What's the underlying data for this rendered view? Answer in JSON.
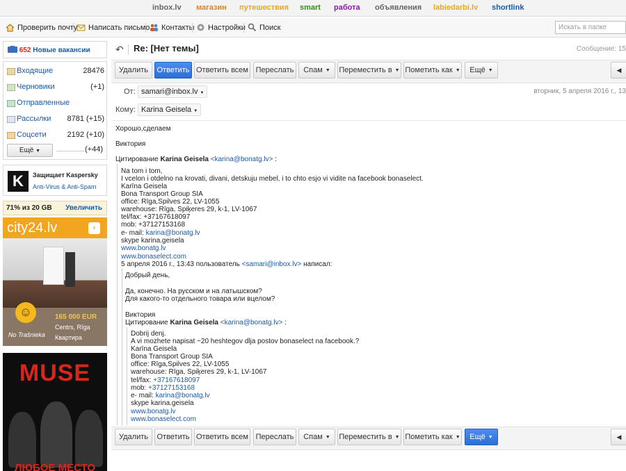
{
  "portal": {
    "links": [
      {
        "label": "inbox.lv",
        "color": "#666666"
      },
      {
        "label": "магазин",
        "color": "#e6821e"
      },
      {
        "label": "путешествия",
        "color": "#e6a81e"
      },
      {
        "label": "smart",
        "color": "#3a8a1a"
      },
      {
        "label": "работа",
        "color": "#8a1aa8"
      },
      {
        "label": "объявления",
        "color": "#666666"
      },
      {
        "label": "labiedarbi.lv",
        "color": "#e6a81e"
      },
      {
        "label": "shortlink",
        "color": "#1a5aa8"
      }
    ]
  },
  "toolbar": {
    "check_mail": "Проверить почту",
    "compose": "Написать письмо",
    "contacts": "Контакты",
    "settings": "Настройки",
    "search": "Поиск",
    "search_placeholder": "Искать в папке"
  },
  "sidebar": {
    "jobs_count": "652",
    "jobs_label": "Новые вакансии",
    "folders": [
      {
        "name": "Входящие",
        "count": "28476"
      },
      {
        "name": "Черновики",
        "count": "(+1)"
      },
      {
        "name": "Отправленные",
        "count": ""
      },
      {
        "name": "Рассылки",
        "count": "8781 (+15)"
      },
      {
        "name": "Соцсети",
        "count": "2192 (+10)"
      }
    ],
    "more_label": "Ещё",
    "more_count": "(+44)",
    "kaspersky_title": "Защищает Kaspersky",
    "kaspersky_sub": "Anti-Virus & Anti-Spam",
    "quota_used": "71% из 20 GB",
    "quota_increase": "Увеличить"
  },
  "ads": {
    "city_brand": "city24.lv",
    "city_noprice": "No Trašnieka",
    "city_price": "165 000 EUR",
    "city_location": "Centrs, Rīga",
    "city_type": "Квартира",
    "muse_title": "MUSE",
    "muse_slogan": "ЛЮБОЕ МЕСТО"
  },
  "message": {
    "subject": "Re: [Нет темы]",
    "message_number": "Сообщение: 15",
    "from_label": "От:",
    "from": "samari@inbox.lv",
    "to_label": "Кому:",
    "to": "Karina Geisela",
    "date": "вторник, 5 апреля 2016 г., 13",
    "actions": {
      "delete": "Удалить",
      "reply": "Ответить",
      "reply_all": "Ответить всем",
      "forward": "Переслать",
      "spam": "Спам",
      "move": "Переместить в",
      "mark": "Пометить как",
      "more": "Ещё"
    },
    "body": {
      "l1": "Хорошо,сделаем",
      "l2": "Виктория",
      "quote1_prefix": "Цитирование ",
      "quote1_name": "Karina Geisela",
      "quote1_email": "<karina@bonatg.lv>",
      "quote1_suffix": " :",
      "q1": [
        "Na tom i tom,",
        "I vcelon i otdelno na krovati, divani, detskuju mebel, i to chto esjo vi vidite na facebook bonaselect.",
        "Karīna Geisela",
        "Bona Transport Group SIA",
        "office: Rīga,Spilves 22, LV-1055",
        "warehouse: Rīga, Spiķeres 29, k-1, LV-1067",
        "tel/fax: +37167618097",
        "mob: +37127153168"
      ],
      "q1_email_label": "e- mail: ",
      "q1_email": "karina@bonatg.lv",
      "q1_skype": "skype karina.geisela",
      "q1_link1": "www.bonatg.lv",
      "q1_link2": "www.bonaselect.com",
      "q1_wrote_prefix": "5 апреля 2016 г., 13:43 пользователь ",
      "q1_wrote_email": "<samari@inbox.lv>",
      "q1_wrote_suffix": " написал:",
      "q2": [
        "Добрый день,",
        "Да, конечно. На русском и на латышском?",
        "Для какого-то отдельного товара или вцелом?",
        "Виктория"
      ],
      "quote2_prefix": "Цитирование ",
      "quote2_name": "Karina Geisela",
      "quote2_email": "<karina@bonatg.lv>",
      "quote2_suffix": " :",
      "q3": [
        "Dobrij denj.",
        "A vi mozhete napisat ~20 heshtegov dlja postov bonaselect na facebook.?",
        "Karīna Geisela",
        "Bona Transport Group SIA",
        "office: Rīga,Spilves 22, LV-1055",
        "warehouse: Rīga, Spiķeres 29, k-1, LV-1067"
      ],
      "q3_tel_label": "tel/fax: ",
      "q3_tel": "+37167618097",
      "q3_mob_label": "mob: ",
      "q3_mob": "+37127153168",
      "q3_email_label": "e- mail: ",
      "q3_email": "karina@bonatg.lv",
      "q3_skype": "skype karina.geisela",
      "q3_link1": "www.bonatg.lv",
      "q3_link2": "www.bonaselect.com"
    }
  }
}
